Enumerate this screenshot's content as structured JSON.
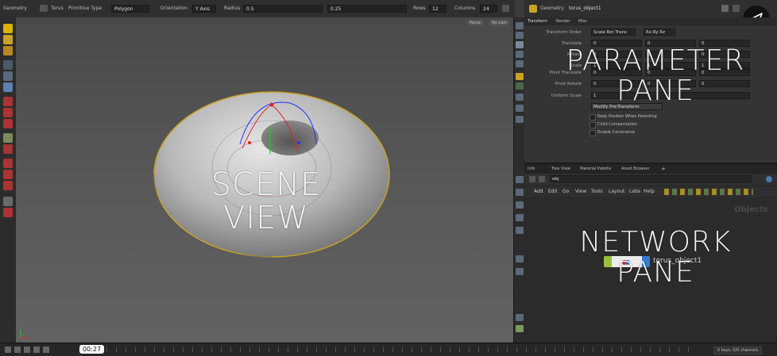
{
  "toolbar": {
    "context": "Geometry",
    "node_type": "Torus",
    "primitive_type_label": "Primitive Type",
    "primitive_type_value": "Polygon",
    "orientation_label": "Orientation",
    "orientation_value": "Y Axis",
    "radius_label": "Radius",
    "radius_value_1": "0.5",
    "radius_value_2": "0.25",
    "rows_label": "Rows",
    "rows_value": "12",
    "columns_label": "Columns",
    "columns_value": "24"
  },
  "viewport": {
    "persp_label": "Persp",
    "camera_label": "No cam"
  },
  "param_pane": {
    "node_context": "Geometry",
    "node_name": "torus_object1",
    "tabs": [
      "Transform",
      "Render",
      "Misc"
    ],
    "transform_order_label": "Transform Order",
    "transform_order_value": "Scale Rot Trans",
    "rotate_order_value": "Rx Ry Rz",
    "translate_label": "Translate",
    "rotate_label": "Rotate",
    "scale_label": "Scale",
    "pivot_translate_label": "Pivot Translate",
    "pivot_rotate_label": "Pivot Rotate",
    "uniform_scale_label": "Uniform Scale",
    "zero": "0",
    "one": "1",
    "modify_pretransform": "Modify Pre-Transform",
    "keep_position": "Keep Position When Parenting",
    "child_compensation": "Child Compensation",
    "enable_constraints": "Enable Constraints"
  },
  "network_pane": {
    "tabs": [
      "Info",
      "Tree View",
      "Material Palette",
      "Asset Browser"
    ],
    "path": "obj",
    "menu": [
      "Add",
      "Edit",
      "Go",
      "View",
      "Tools",
      "Layout",
      "Labs",
      "Help"
    ],
    "context_label": "Objects",
    "node_label": "torus_object1"
  },
  "timeline": {
    "time_badge": "00:27",
    "keys_label": "0 keys, 0/0 channels"
  },
  "overlays": {
    "scene_view_label": "SCENE VIEW",
    "parameter_line1": "PARAMETER",
    "parameter_line2": "PANE",
    "network_line1": "NETWORK",
    "network_line2": "PANE"
  },
  "colors": {
    "accent_yellow": "#c9a227",
    "axis_red": "#d22",
    "axis_blue": "#23f",
    "axis_green": "#2c2"
  }
}
